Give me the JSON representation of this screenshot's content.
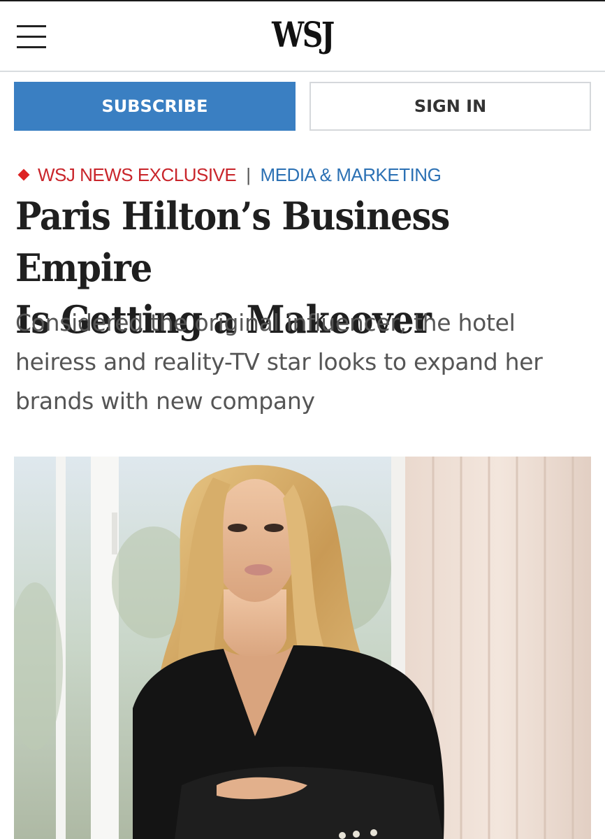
{
  "header": {
    "logo": "WSJ"
  },
  "actions": {
    "subscribe_label": "SUBSCRIBE",
    "signin_label": "SIGN IN"
  },
  "article": {
    "kicker_exclusive": "WSJ NEWS EXCLUSIVE",
    "kicker_separator": "|",
    "kicker_section": "MEDIA & MARKETING",
    "headline_line1": "Paris Hilton’s Business Empire",
    "headline_line2": "Is Getting a Makeover",
    "dek_line1": "Considered the original influencer, the hotel",
    "dek_line2": "heiress and reality-TV star looks to expand her",
    "dek_line3": "brands with new company"
  },
  "colors": {
    "subscribe_bg": "#3a7fc2",
    "kicker_red": "#c9252b",
    "kicker_blue": "#2c71b4",
    "headline": "#1f1f1f",
    "dek": "#555555"
  },
  "icons": {
    "menu": "hamburger-menu-icon",
    "exclusive_marker": "red-diamond-icon"
  }
}
